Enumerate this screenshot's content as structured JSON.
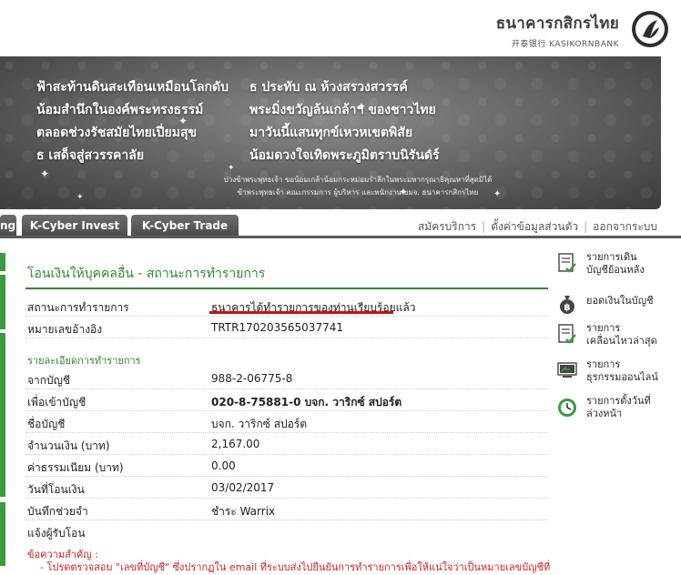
{
  "bank": {
    "name_thai": "ธนาคารกสิกรไทย",
    "name_en": "开泰银行 KASIKORNBANK"
  },
  "banner": {
    "poem_left": [
      "ฟ้าสะท้านดินสะเทือนเหมือนโลกดับ",
      "น้อมสำนึกในองค์พระทรงธรรม์",
      "ตลอดช่วงรัชสมัยไทยเปี่ยมสุข",
      "ธ เสด็จสู่สวรรคาลัย"
    ],
    "poem_right": [
      "ธ ประทับ ณ ห้วงสรวงสวรรค์",
      "พระมิ่งขวัญล้นเกล้าฯ ของชาวไทย",
      "มาวันนี้แสนทุกข์เหวหเขตพิสัย",
      "น้อมดวงใจเทิดพระภูมิตราบนิรันดร์"
    ],
    "sub_line1": "ปวงข้าพระพุทธเจ้า ขอน้อมเกล้าน้อมกระหม่อมรำลึกในพระมหากรุณาธิคุณหาที่สุดมิได้",
    "sub_line2": "ข้าพระพุทธเจ้า คณะกรรมการ ผู้บริหาร และพนักงาน บมจ. ธนาคารกสิกรไทย"
  },
  "nav": {
    "tabs": [
      "ng",
      "K-Cyber Invest",
      "K-Cyber Trade"
    ],
    "links": [
      "สมัครบริการ",
      "ตั้งค่าข้อมูลส่วนตัว",
      "ออกจากระบบ"
    ]
  },
  "page": {
    "title": "โอนเงินให้บุคคลอื่น - สถานะการทำรายการ",
    "status_label": "สถานะการทำรายการ",
    "status_value": "ธนาคารได้ทำรายการของท่านเรียบร้อยแล้ว",
    "ref_label": "หมายเลขอ้างอิง",
    "ref_value": "TRTR170203565037741",
    "details_heading": "รายละเอียดการทำรายการ",
    "details": [
      {
        "label": "จากบัญชี",
        "value": "988-2-06775-8",
        "bold": false
      },
      {
        "label": "เพื่อเข้าบัญชี",
        "value": "020-8-75881-0 บจก. วาริกซ์ สปอร์ต",
        "bold": true
      },
      {
        "label": "ชื่อบัญชี",
        "value": "บจก. วาริกซ์ สปอร์ต",
        "bold": false
      },
      {
        "label": "จำนวนเงิน (บาท)",
        "value": "2,167.00",
        "bold": false
      },
      {
        "label": "ค่าธรรมเนียม (บาท)",
        "value": "0.00",
        "bold": false
      },
      {
        "label": "วันที่โอนเงิน",
        "value": "03/02/2017",
        "bold": false
      },
      {
        "label": "บันทึกช่วยจำ",
        "value": "ชำระ Warrix",
        "bold": false
      },
      {
        "label": "แจ้งผู้รับโอน",
        "value": "",
        "bold": false
      }
    ],
    "note_title": "ข้อความสำคัญ :",
    "note_body": "- โปรดตรวจสอบ \"เลขที่บัญชี\" ซึ่งปรากฏใน email ที่ระบบส่งไปยืนยันการทำรายการเพื่อให้แน่ใจว่าเป็นหมายเลขบัญชีที่"
  },
  "sidebar": {
    "items": [
      {
        "line1": "รายการเดิน",
        "line2": "บัญชีย้อนหลัง",
        "icon": "statement-icon"
      },
      {
        "line1": "ยอดเงินในบัญชี",
        "line2": "",
        "icon": "money-bag-icon"
      },
      {
        "line1": "รายการ",
        "line2": "เคลื่อนไหวล่าสุด",
        "icon": "recent-activity-icon"
      },
      {
        "line1": "รายการ",
        "line2": "ธุรกรรมออนไลน์",
        "icon": "online-transaction-icon"
      },
      {
        "line1": "รายการตั้งวันที่",
        "line2": "ล่วงหน้า",
        "icon": "clock-icon"
      }
    ]
  },
  "colors": {
    "brand_green": "#2f8a2f",
    "alert_red": "#d41f1f",
    "tab_gray": "#5a5a5a"
  }
}
